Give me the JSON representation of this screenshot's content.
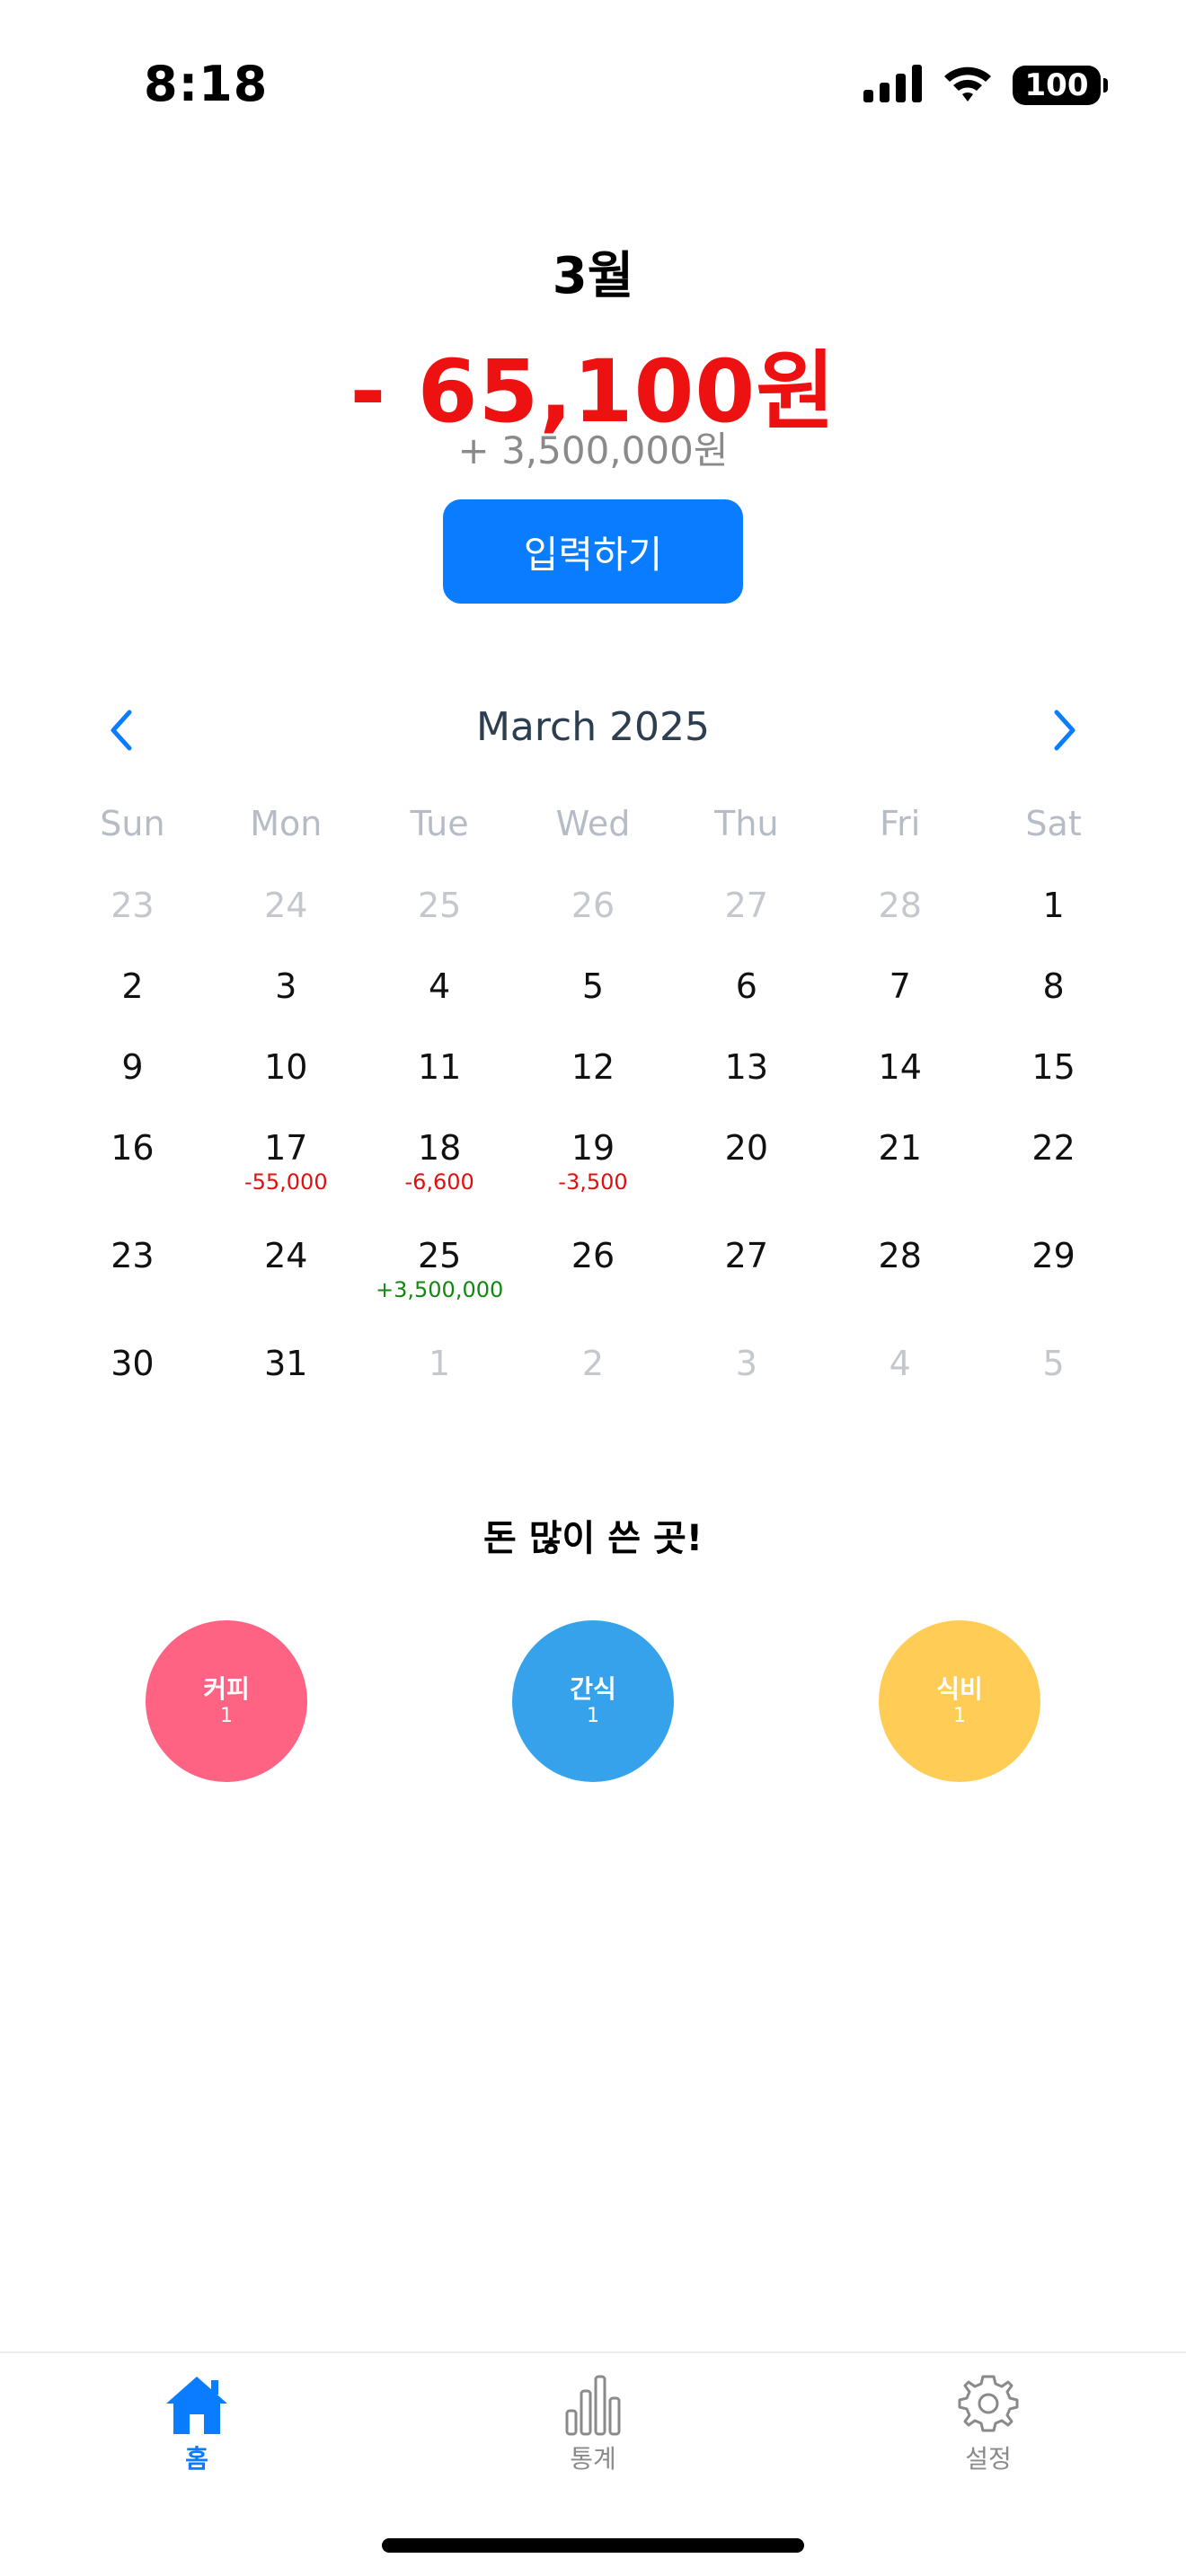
{
  "status_bar": {
    "time": "8:18",
    "battery": "100",
    "icons": [
      "cellular-signal-icon",
      "wifi-icon",
      "battery-icon"
    ]
  },
  "summary": {
    "month": "3월",
    "expense_total": "- 65,100원",
    "income_total": "+ 3,500,000원",
    "input_button": "입력하기"
  },
  "calendar": {
    "title": "March 2025",
    "weekdays": [
      "Sun",
      "Mon",
      "Tue",
      "Wed",
      "Thu",
      "Fri",
      "Sat"
    ],
    "weeks": [
      [
        {
          "day": "23",
          "muted": true
        },
        {
          "day": "24",
          "muted": true
        },
        {
          "day": "25",
          "muted": true
        },
        {
          "day": "26",
          "muted": true
        },
        {
          "day": "27",
          "muted": true
        },
        {
          "day": "28",
          "muted": true
        },
        {
          "day": "1"
        }
      ],
      [
        {
          "day": "2"
        },
        {
          "day": "3"
        },
        {
          "day": "4"
        },
        {
          "day": "5"
        },
        {
          "day": "6"
        },
        {
          "day": "7"
        },
        {
          "day": "8"
        }
      ],
      [
        {
          "day": "9"
        },
        {
          "day": "10"
        },
        {
          "day": "11"
        },
        {
          "day": "12"
        },
        {
          "day": "13"
        },
        {
          "day": "14"
        },
        {
          "day": "15"
        }
      ],
      [
        {
          "day": "16"
        },
        {
          "day": "17",
          "amount": "-55,000",
          "kind": "expense"
        },
        {
          "day": "18",
          "amount": "-6,600",
          "kind": "expense"
        },
        {
          "day": "19",
          "amount": "-3,500",
          "kind": "expense"
        },
        {
          "day": "20"
        },
        {
          "day": "21"
        },
        {
          "day": "22"
        }
      ],
      [
        {
          "day": "23"
        },
        {
          "day": "24"
        },
        {
          "day": "25",
          "amount": "+3,500,000",
          "kind": "income"
        },
        {
          "day": "26"
        },
        {
          "day": "27"
        },
        {
          "day": "28"
        },
        {
          "day": "29"
        }
      ],
      [
        {
          "day": "30"
        },
        {
          "day": "31"
        },
        {
          "day": "1",
          "muted": true
        },
        {
          "day": "2",
          "muted": true
        },
        {
          "day": "3",
          "muted": true
        },
        {
          "day": "4",
          "muted": true
        },
        {
          "day": "5",
          "muted": true
        }
      ]
    ],
    "colors": {
      "expense": "#e01010",
      "income": "#118811",
      "accent": "#0a7cff"
    }
  },
  "top_spending": {
    "title": "돈 많이 쓴 곳!",
    "categories": [
      {
        "name": "커피",
        "count": "1",
        "color": "#ff6384"
      },
      {
        "name": "간식",
        "count": "1",
        "color": "#36a2eb"
      },
      {
        "name": "식비",
        "count": "1",
        "color": "#ffcd56"
      }
    ]
  },
  "tabs": [
    {
      "label": "홈",
      "icon": "home-icon",
      "active": true
    },
    {
      "label": "통계",
      "icon": "bar-chart-icon",
      "active": false
    },
    {
      "label": "설정",
      "icon": "gear-icon",
      "active": false
    }
  ]
}
